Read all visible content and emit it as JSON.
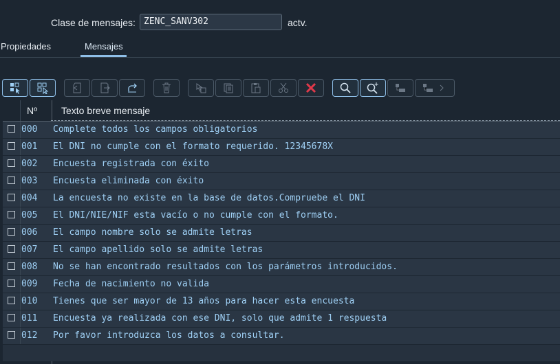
{
  "header": {
    "label": "Clase de mensajes:",
    "value": "ZENC_SANV302",
    "suffix": "actv."
  },
  "tabs": [
    {
      "label": "Propiedades",
      "selected": false
    },
    {
      "label": "Mensajes",
      "selected": true
    }
  ],
  "toolbar": {
    "icons": [
      "select-all-icon",
      "deselect-all-icon",
      "copy-rows-icon",
      "export-icon",
      "redo-icon",
      "delete-icon",
      "details-icon",
      "copy-icon",
      "paste-icon",
      "cut-icon",
      "close-icon",
      "search-icon",
      "search-next-icon",
      "layout-icon",
      "layout-more-icon"
    ],
    "accent": "#8fbfe8",
    "delete_color": "#e0394a"
  },
  "table": {
    "columns": [
      "Nº",
      "Texto breve mensaje"
    ],
    "rows": [
      {
        "num": "000",
        "text": "Complete todos los campos obligatorios"
      },
      {
        "num": "001",
        "text": "El DNI no cumple con el formato requerido. 12345678X"
      },
      {
        "num": "002",
        "text": "Encuesta registrada con éxito"
      },
      {
        "num": "003",
        "text": "Encuesta eliminada con éxito"
      },
      {
        "num": "004",
        "text": "La encuesta no existe en la base de datos.Compruebe el DNI"
      },
      {
        "num": "005",
        "text": "El DNI/NIE/NIF esta vacío o no cumple con el formato."
      },
      {
        "num": "006",
        "text": "El campo nombre solo se admite letras"
      },
      {
        "num": "007",
        "text": "El campo apellido solo se admite letras"
      },
      {
        "num": "008",
        "text": "No se han encontrado resultados con los parámetros introducidos."
      },
      {
        "num": "009",
        "text": "Fecha de nacimiento no valida"
      },
      {
        "num": "010",
        "text": "Tienes que ser mayor de 13 años para hacer esta encuesta"
      },
      {
        "num": "011",
        "text": "Encuesta ya realizada con ese DNI, solo que admite 1 respuesta"
      },
      {
        "num": "012",
        "text": "Por favor introduzca los datos a consultar."
      }
    ]
  }
}
